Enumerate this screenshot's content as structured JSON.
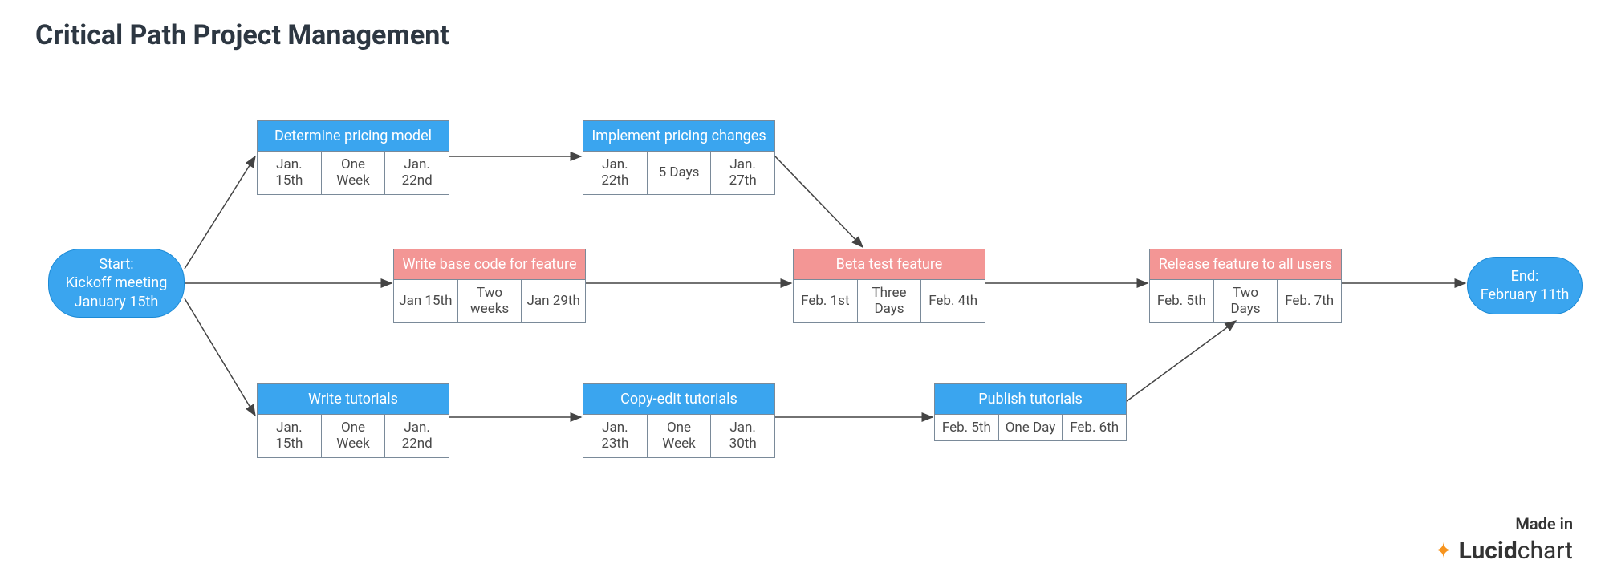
{
  "title": "Critical Path Project Management",
  "start": {
    "line1": "Start:",
    "line2": "Kickoff meeting",
    "line3": "January 15th"
  },
  "end": {
    "line1": "End:",
    "line2": "February 11th"
  },
  "tasks": {
    "determine_pricing": {
      "label": "Determine pricing model",
      "start": "Jan. 15th",
      "duration": "One Week",
      "end": "Jan. 22nd",
      "color": "blue"
    },
    "implement_pricing": {
      "label": "Implement pricing changes",
      "start": "Jan. 22th",
      "duration": "5 Days",
      "end": "Jan. 27th",
      "color": "blue"
    },
    "write_base_code": {
      "label": "Write base code for feature",
      "start": "Jan 15th",
      "duration": "Two weeks",
      "end": "Jan 29th",
      "color": "red"
    },
    "beta_test": {
      "label": "Beta test feature",
      "start": "Feb. 1st",
      "duration": "Three Days",
      "end": "Feb. 4th",
      "color": "red"
    },
    "release_feature": {
      "label": "Release feature to all users",
      "start": "Feb. 5th",
      "duration": "Two Days",
      "end": "Feb. 7th",
      "color": "red"
    },
    "write_tutorials": {
      "label": "Write tutorials",
      "start": "Jan. 15th",
      "duration": "One Week",
      "end": "Jan. 22nd",
      "color": "blue"
    },
    "copy_edit": {
      "label": "Copy-edit tutorials",
      "start": "Jan. 23th",
      "duration": "One Week",
      "end": "Jan. 30th",
      "color": "blue"
    },
    "publish_tutorials": {
      "label": "Publish tutorials",
      "start": "Feb. 5th",
      "duration": "One Day",
      "end": "Feb. 6th",
      "color": "blue"
    }
  },
  "footer": {
    "madein": "Made in",
    "brand_bold": "Lucid",
    "brand_light": "chart"
  },
  "colors": {
    "blue": "#3aa5ef",
    "red": "#f39695",
    "border": "#7a8a99",
    "arrow": "#444444"
  }
}
